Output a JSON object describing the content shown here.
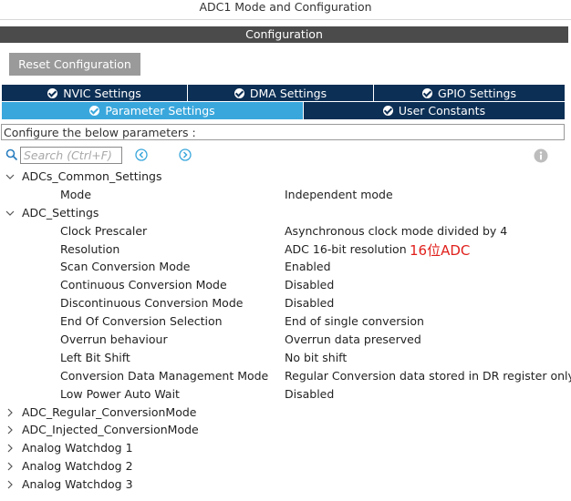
{
  "window": {
    "title": "ADC1 Mode and Configuration"
  },
  "config_header": "Configuration",
  "reset_button": "Reset Configuration",
  "tabs_row1": [
    {
      "label": "NVIC Settings"
    },
    {
      "label": "DMA Settings"
    },
    {
      "label": "GPIO Settings"
    }
  ],
  "tabs_row2": [
    {
      "label": "Parameter Settings",
      "active": true
    },
    {
      "label": "User Constants",
      "active": false
    }
  ],
  "hint": "Configure the below parameters :",
  "search": {
    "placeholder": "Search (Ctrl+F)"
  },
  "tree": {
    "adcs_common": {
      "label": "ADCs_Common_Settings",
      "params": [
        {
          "name": "Mode",
          "value": "Independent mode"
        }
      ]
    },
    "adc_settings": {
      "label": "ADC_Settings",
      "params": [
        {
          "name": "Clock Prescaler",
          "value": "Asynchronous clock mode divided by 4"
        },
        {
          "name": "Resolution",
          "value": "ADC 16-bit resolution"
        },
        {
          "name": "Scan Conversion Mode",
          "value": "Enabled"
        },
        {
          "name": "Continuous Conversion Mode",
          "value": "Disabled"
        },
        {
          "name": "Discontinuous Conversion Mode",
          "value": "Disabled"
        },
        {
          "name": "End Of Conversion Selection",
          "value": "End of single conversion"
        },
        {
          "name": "Overrun behaviour",
          "value": "Overrun data preserved"
        },
        {
          "name": "Left Bit Shift",
          "value": "No bit shift"
        },
        {
          "name": "Conversion Data Management Mode",
          "value": "Regular Conversion data stored in DR register only"
        },
        {
          "name": "Low Power Auto Wait",
          "value": "Disabled"
        }
      ]
    },
    "collapsed": [
      {
        "label": "ADC_Regular_ConversionMode"
      },
      {
        "label": "ADC_Injected_ConversionMode"
      },
      {
        "label": "Analog Watchdog 1"
      },
      {
        "label": "Analog Watchdog 2"
      },
      {
        "label": "Analog Watchdog 3"
      }
    ]
  },
  "annotation": "16位ADC",
  "colors": {
    "tab_bg": "#0c2f55",
    "tab_active": "#3aa7dc",
    "header_bar": "#4b4b4b",
    "annotation": "#e0201c",
    "nav_icon": "#3aa7dc"
  }
}
